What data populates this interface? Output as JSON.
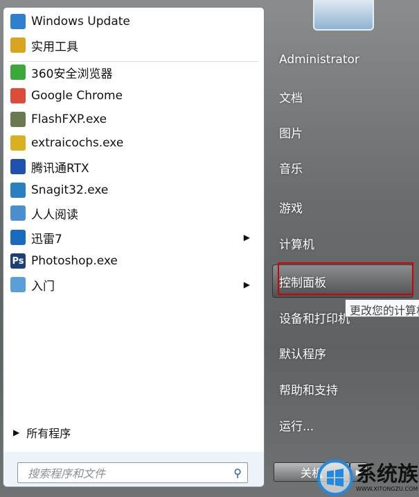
{
  "programs": [
    {
      "label": "Windows Update",
      "icon": "windows-update-icon",
      "color": "#2f7fd0"
    },
    {
      "label": "实用工具",
      "icon": "folder-icon",
      "color": "#d9a520"
    },
    {
      "label": "360安全浏览器",
      "icon": "360-browser-icon",
      "color": "#3aa83a"
    },
    {
      "label": "Google Chrome",
      "icon": "chrome-icon",
      "color": "#dd4b39"
    },
    {
      "label": "FlashFXP.exe",
      "icon": "flashfxp-icon",
      "color": "#6a7a50"
    },
    {
      "label": "extraicochs.exe",
      "icon": "extraico-icon",
      "color": "#d8b020"
    },
    {
      "label": "腾讯通RTX",
      "icon": "rtx-icon",
      "color": "#2050b0"
    },
    {
      "label": "Snagit32.exe",
      "icon": "snagit-icon",
      "color": "#2a7fc0"
    },
    {
      "label": "人人阅读",
      "icon": "renren-reader-icon",
      "color": "#4a90d0"
    },
    {
      "label": "迅雷7",
      "icon": "thunder-icon",
      "color": "#1a6ac0",
      "submenu": true
    },
    {
      "label": "Photoshop.exe",
      "icon": "photoshop-icon",
      "color": "#1c3f7a",
      "badge": "Ps"
    },
    {
      "label": "入门",
      "icon": "getting-started-icon",
      "color": "#5aa0d8",
      "submenu": true
    }
  ],
  "all_programs": "所有程序",
  "search_placeholder": "搜索程序和文件",
  "right_items": [
    "Administrator",
    "文档",
    "图片",
    "音乐",
    "游戏",
    "计算机",
    "控制面板",
    "设备和打印机",
    "默认程序",
    "帮助和支持",
    "运行..."
  ],
  "tooltip": "更改您的计算机",
  "shutdown": "关机",
  "watermark": {
    "name": "系统族",
    "url": "WWW.XITONGZU.COM"
  }
}
